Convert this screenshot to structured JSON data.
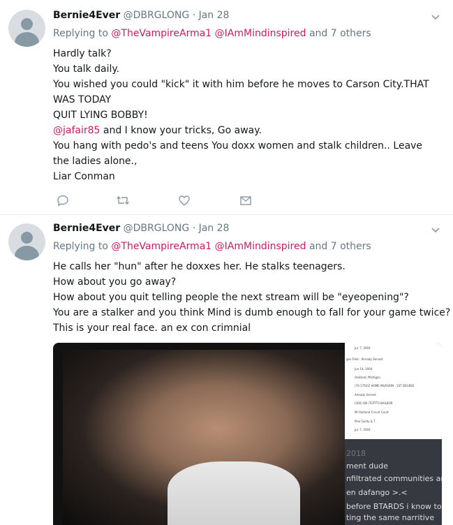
{
  "tweets": [
    {
      "name": "Bernie4Ever",
      "handle": "@DBRGLONG",
      "date": "Jan 28",
      "replying_prefix": "Replying to",
      "mention1": "@TheVampireArma1",
      "mention2": "@IAmMindinspired",
      "others": "and 7 others",
      "lines": [
        "Hardly talk?",
        "You talk daily.",
        "You wished you could \"kick\" it with him before he moves to Carson City.THAT WAS TODAY",
        "QUIT LYING BOBBY!",
        "and I know your tricks, Go away.",
        "You hang with pedo's and teens You doxx women and stalk children.. Leave the ladies alone.,",
        "Liar Conman"
      ],
      "inline_mention": "@jafair85"
    },
    {
      "name": "Bernie4Ever",
      "handle": "@DBRGLONG",
      "date": "Jan 28",
      "replying_prefix": "Replying to",
      "mention1": "@TheVampireArma1",
      "mention2": "@IAmMindinspired",
      "others": "and 7 others",
      "lines": [
        "He calls her \"hun\" after he doxxes her. He stalks teenagers.",
        "How about you go away?",
        "How about you quit telling people the next stream will be \"eyeopening\"?",
        "You are a stalker and you think Mind is dumb enough to fall for your game twice?",
        "This is your real face. an ex con crimnial"
      ],
      "media": {
        "doc_lines": [
          "Jul. 7, 2004",
          "ges Filed - Already Served",
          "Jun 14, 2004",
          "Oakland, Michigan",
          "(70.1750)2 HOME INVASION - 1ST DEGREE",
          "Already Served",
          "(300) ON (TCPTTS BAILBOR",
          "MI Oakland Circuit Court",
          "Plea Guilty & T",
          "Jul. 7, 2004"
        ],
        "chat_lines": [
          "2018",
          "ment dude",
          "nfiltrated communities an",
          "en dafango >.<",
          "before BTARDS i know to",
          "ting the same narritive"
        ]
      }
    }
  ],
  "icons": [
    "reply-icon",
    "retweet-icon",
    "like-icon",
    "dm-icon",
    "chevron-down-icon",
    "avatar"
  ],
  "colors": {
    "mention": "#d0195e",
    "secondary": "#657786",
    "text": "#14171a"
  }
}
